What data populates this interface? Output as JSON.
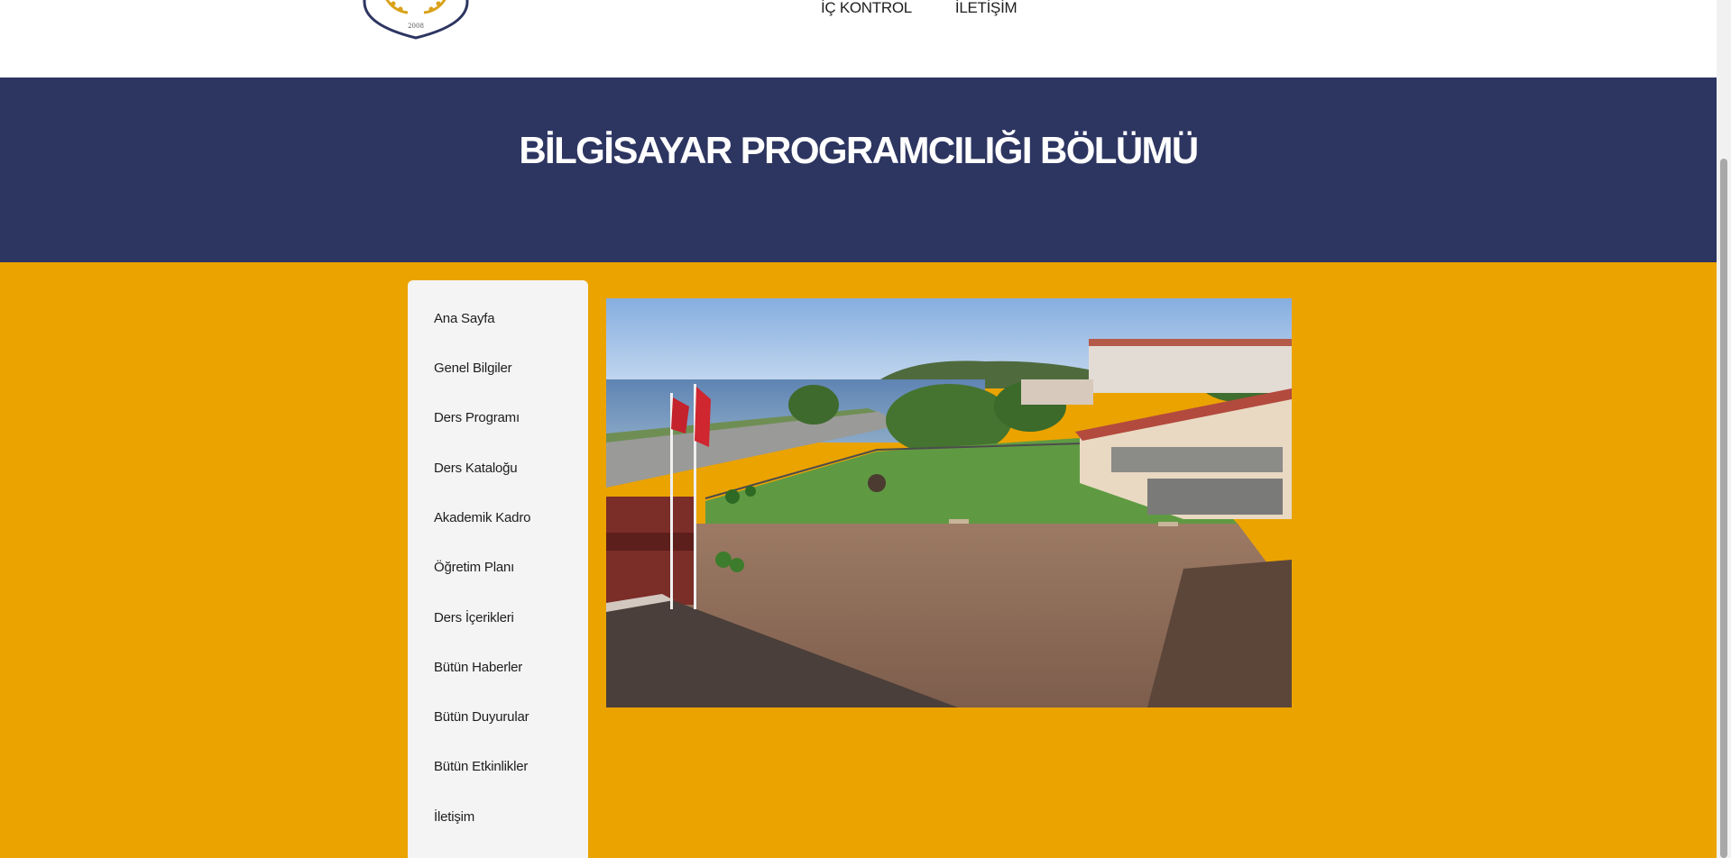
{
  "header": {
    "logo_year": "2008",
    "nav": [
      {
        "label": "İÇ KONTROL"
      },
      {
        "label": "İLETİŞİM"
      }
    ]
  },
  "hero": {
    "title": "BİLGİSAYAR PROGRAMCILIĞI BÖLÜMÜ"
  },
  "sidebar": {
    "items": [
      {
        "label": "Ana Sayfa"
      },
      {
        "label": "Genel Bilgiler"
      },
      {
        "label": "Ders Programı"
      },
      {
        "label": "Ders Kataloğu"
      },
      {
        "label": "Akademik Kadro"
      },
      {
        "label": "Öğretim Planı"
      },
      {
        "label": "Ders İçerikleri"
      },
      {
        "label": "Bütün Haberler"
      },
      {
        "label": "Bütün Duyurular"
      },
      {
        "label": "Bütün Etkinlikler"
      },
      {
        "label": "İletişim"
      }
    ]
  },
  "colors": {
    "hero_bg": "#2d3561",
    "page_bg": "#eba300",
    "sidebar_bg": "#f4f4f4"
  }
}
